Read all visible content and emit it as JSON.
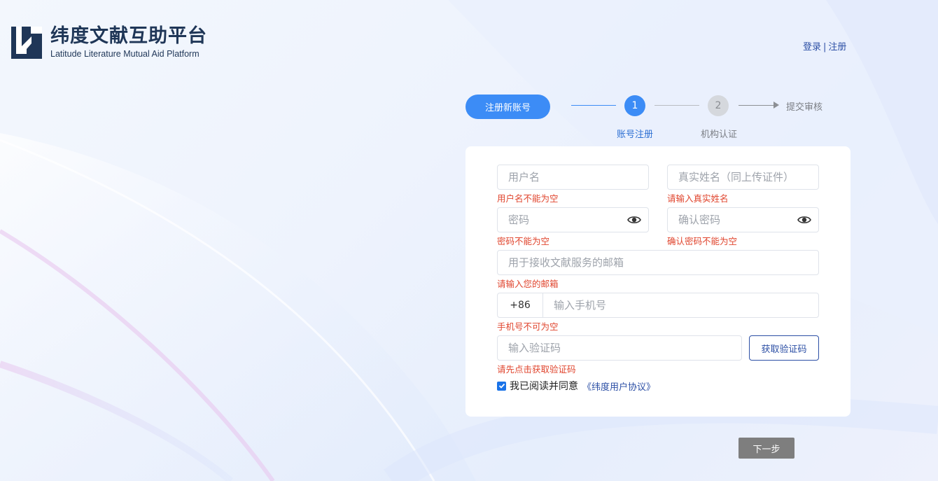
{
  "brand": {
    "name_cn": "纬度文献互助平台",
    "name_en": "Latitude Literature Mutual Aid Platform"
  },
  "top_links": {
    "login": "登录",
    "separator": "|",
    "register": "注册"
  },
  "steps": {
    "pill": "注册新账号",
    "step1_number": "1",
    "step1_label": "账号注册",
    "step2_number": "2",
    "step2_label": "机构认证",
    "final": "提交审核"
  },
  "form": {
    "username": {
      "placeholder": "用户名",
      "error": "用户名不能为空"
    },
    "realname": {
      "placeholder": "真实姓名（同上传证件）",
      "error": "请输入真实姓名"
    },
    "password": {
      "placeholder": "密码",
      "error": "密码不能为空"
    },
    "confirm_password": {
      "placeholder": "确认密码",
      "error": "确认密码不能为空"
    },
    "email": {
      "placeholder": "用于接收文献服务的邮箱",
      "error": "请输入您的邮箱"
    },
    "phone": {
      "prefix": "+86",
      "placeholder": "输入手机号",
      "error": "手机号不可为空"
    },
    "code": {
      "placeholder": "输入验证码",
      "button": "获取验证码",
      "error": "请先点击获取验证码"
    },
    "agree": {
      "text": "我已阅读并同意",
      "link": "《纬度用户协议》",
      "checked": true
    }
  },
  "next_button": "下一步",
  "colors": {
    "primary": "#3c8cf6",
    "error": "#e0452e",
    "link": "#2c4fa5",
    "brand_dark": "#1f3657"
  }
}
